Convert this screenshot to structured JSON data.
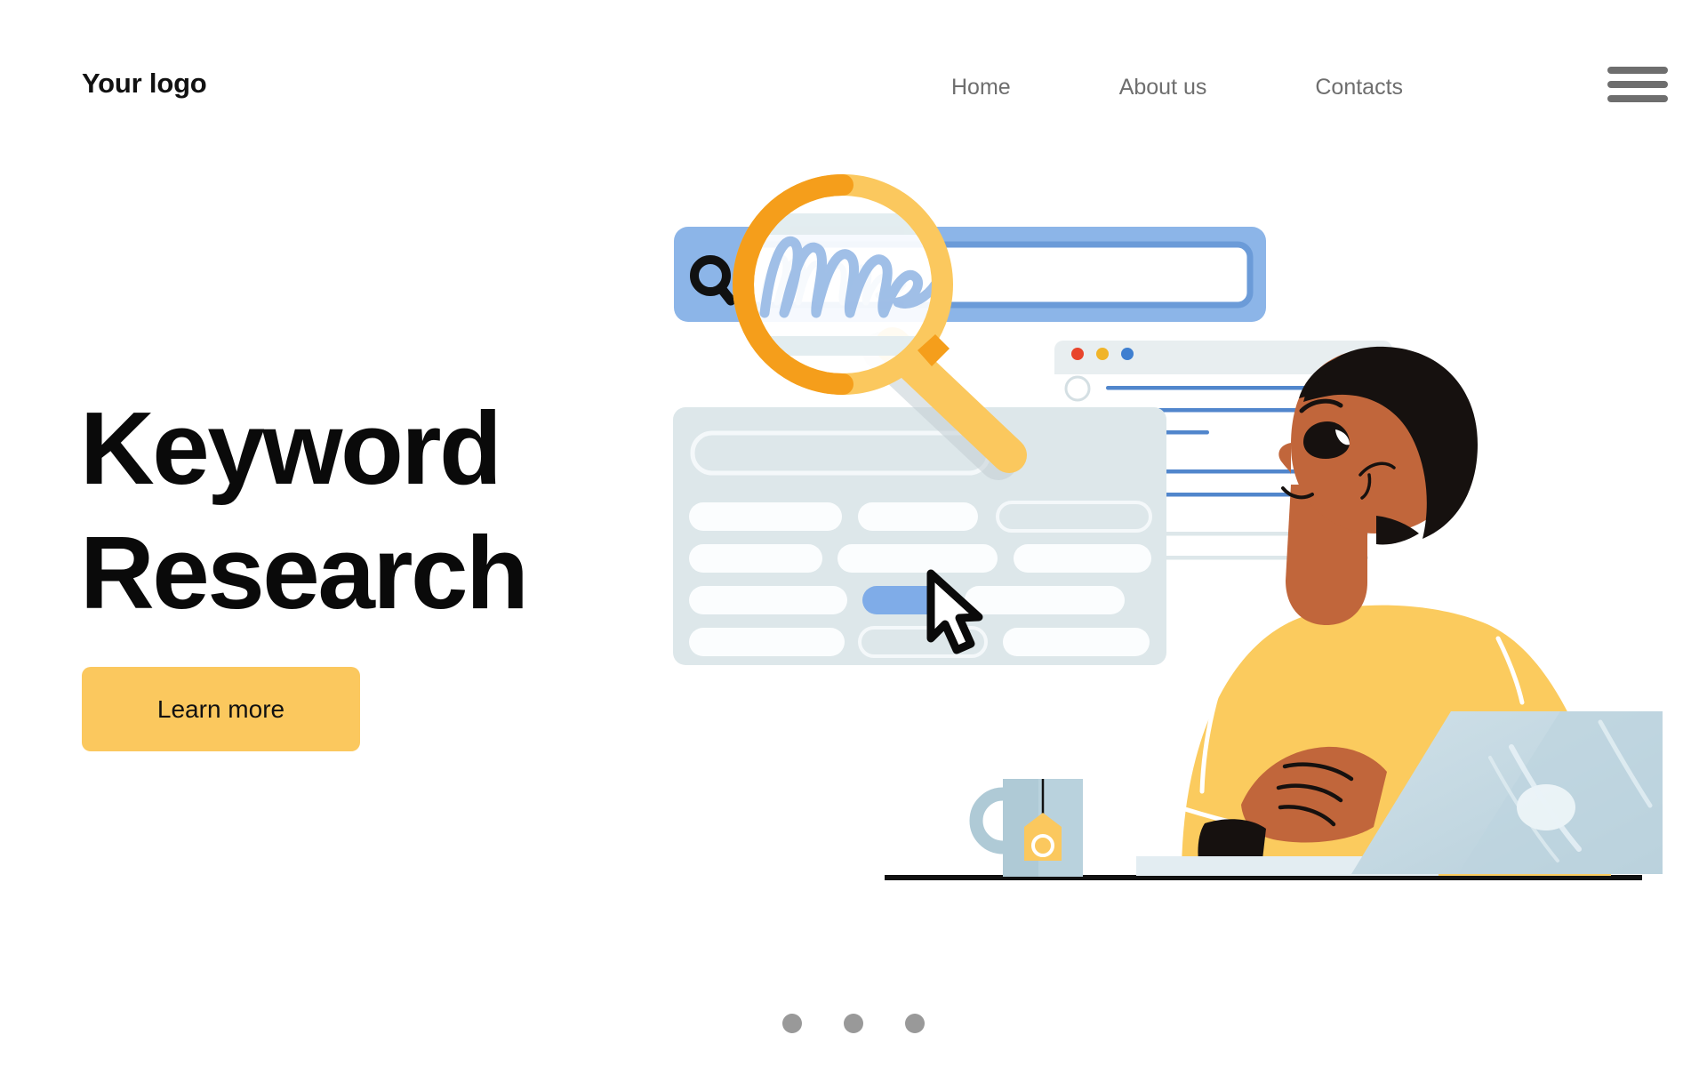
{
  "header": {
    "logo": "Your logo",
    "nav": [
      {
        "label": "Home"
      },
      {
        "label": "About us"
      },
      {
        "label": "Contacts"
      }
    ],
    "menu_icon": "hamburger-menu-icon"
  },
  "hero": {
    "headline_line1": "Keyword",
    "headline_line2": "Research",
    "cta_label": "Learn more"
  },
  "illustration": {
    "name": "keyword-research-illustration",
    "search_bar": {
      "icon": "search-icon",
      "query_text": "handwritten-squiggle"
    },
    "magnifier": {
      "name": "magnifying-glass"
    },
    "results_panel": {
      "name": "search-results-panel",
      "rows": 5
    },
    "browser_window": {
      "name": "browser-window",
      "traffic_lights": [
        "#E8452C",
        "#F0B429",
        "#3F7FD0"
      ]
    },
    "cursor": {
      "name": "mouse-cursor"
    },
    "person": {
      "name": "person-at-laptop"
    },
    "mug": {
      "name": "coffee-mug"
    },
    "laptop": {
      "name": "laptop"
    }
  },
  "carousel": {
    "dots": [
      {
        "active": false
      },
      {
        "active": false
      },
      {
        "active": false
      }
    ]
  },
  "colors": {
    "accent_yellow": "#FBC85E",
    "accent_orange": "#F59E1B",
    "blue": "#8CB5E8",
    "blue_dark": "#6B9BD8",
    "panel_gray": "#DDE7EA",
    "skin": "#C1663B",
    "hair": "#16110F",
    "sweater": "#FBCB5E",
    "laptop": "#C7DAE3",
    "nav_text": "#6e6e6e",
    "headline": "#0a0a0a"
  }
}
